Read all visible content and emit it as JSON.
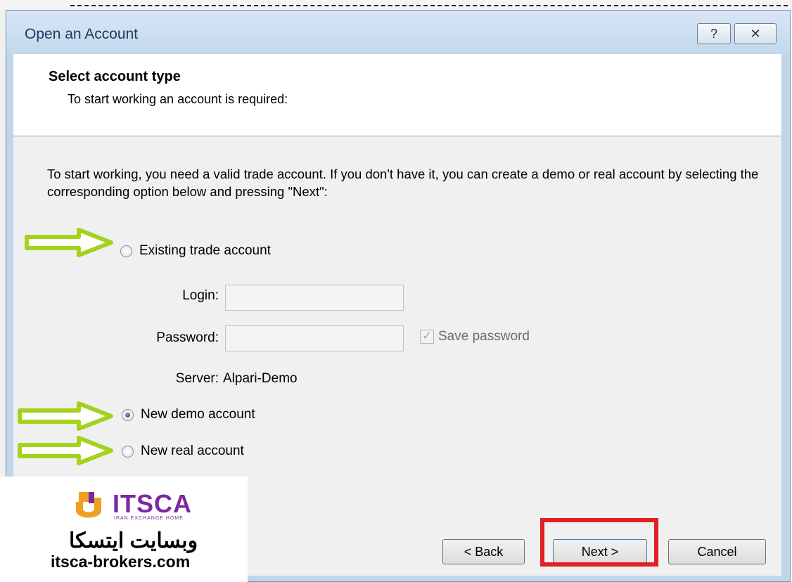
{
  "dialog": {
    "title": "Open an Account",
    "help_glyph": "?",
    "close_glyph": "✕"
  },
  "header": {
    "title": "Select account type",
    "subtitle": "To start working an account is required:"
  },
  "description": "To start working, you need a valid trade account. If you don't have it, you can create a demo or real account by selecting the corresponding option below and pressing \"Next\":",
  "options": [
    {
      "label": "Existing trade account",
      "checked": false
    },
    {
      "label": "New demo account",
      "checked": true
    },
    {
      "label": "New real account",
      "checked": false
    }
  ],
  "fields": {
    "login_label": "Login:",
    "login_value": "",
    "password_label": "Password:",
    "password_value": "",
    "save_password_label": "Save password",
    "save_password_checked": true,
    "server_label": "Server:",
    "server_value": "Alpari-Demo"
  },
  "buttons": {
    "back": "< Back",
    "next": "Next >",
    "cancel": "Cancel"
  },
  "annotations": {
    "arrow_color": "#a4d21c",
    "highlight_color": "#e01f26"
  },
  "watermark": {
    "brand": "ITSCA",
    "tagline": "IRAN EXCHANGE HOME",
    "persian_text": "وبسایت ایتسکا",
    "url": "itsca-brokers.com"
  }
}
